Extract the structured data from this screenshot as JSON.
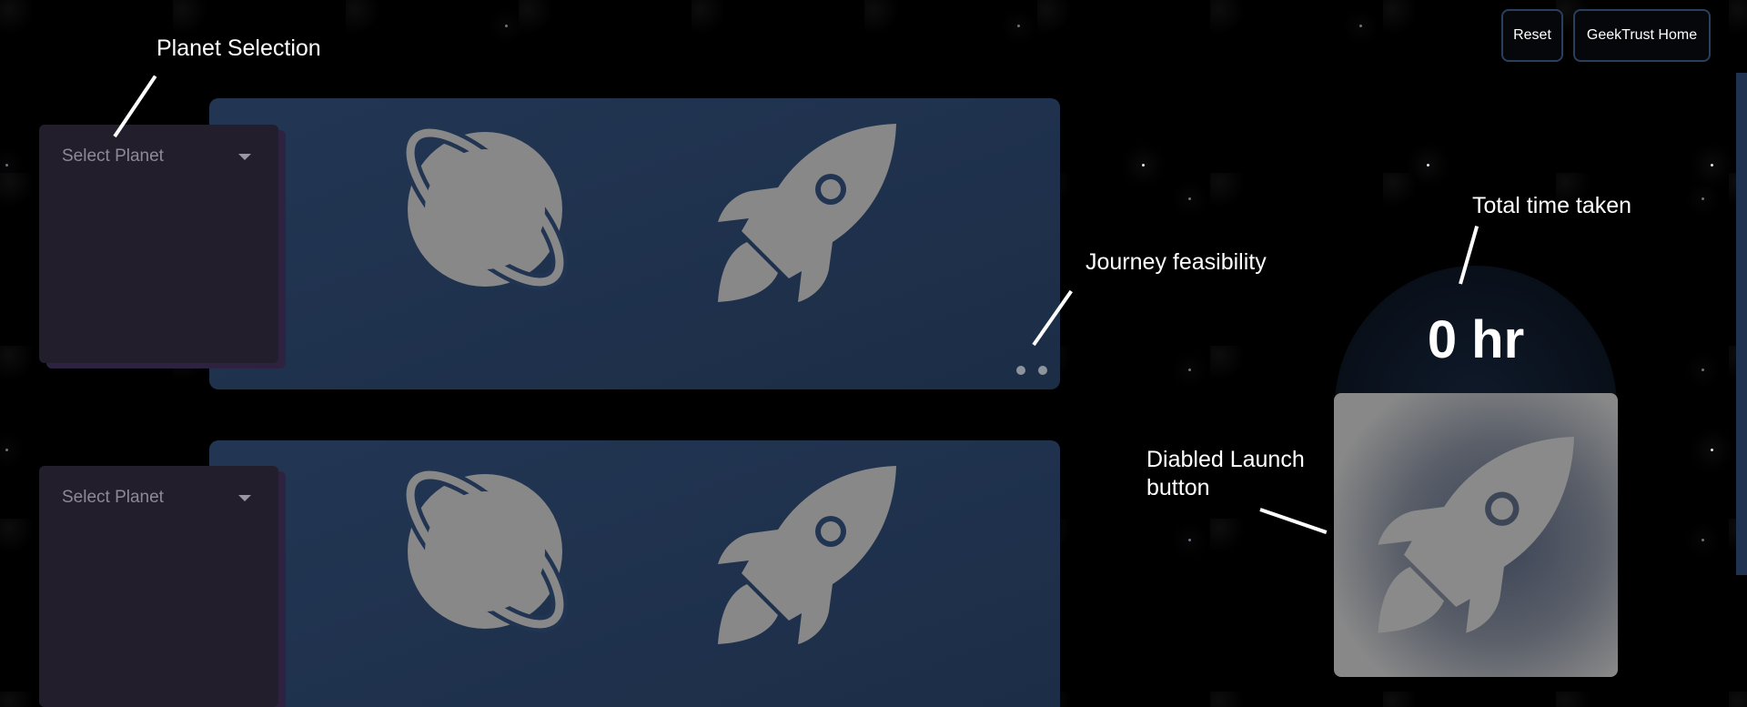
{
  "header": {
    "reset_label": "Reset",
    "home_label": "GeekTrust Home"
  },
  "destinations": [
    {
      "select_placeholder": "Select Planet",
      "planet_icon": "planet-icon",
      "vehicle_icon": "rocket-icon"
    },
    {
      "select_placeholder": "Select Planet",
      "planet_icon": "planet-icon",
      "vehicle_icon": "rocket-icon"
    }
  ],
  "summary": {
    "time_taken": "0 hr",
    "launch_icon": "rocket-icon",
    "launch_enabled": false
  },
  "annotations": {
    "planet_selection": "Planet Selection",
    "journey_feasibility": "Journey feasibility",
    "total_time": "Total time taken",
    "launch_line1": "Diabled Launch",
    "launch_line2": "button"
  },
  "colors": {
    "background": "#000000",
    "panel": "#1f314c",
    "card": "#221e2c",
    "icon": "#888888",
    "button_border": "#2a3f5c"
  }
}
